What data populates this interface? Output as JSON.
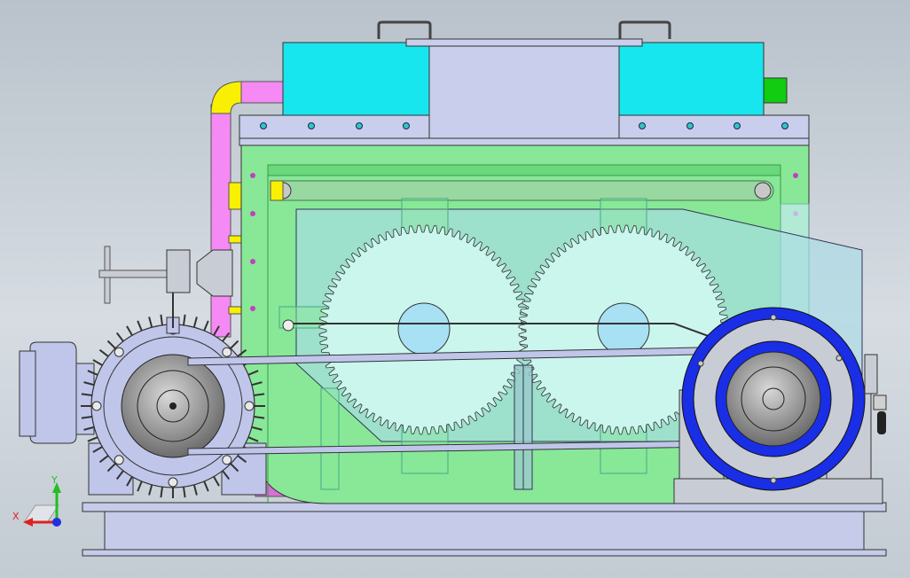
{
  "viewport": {
    "background_top": "#b9c2cb",
    "background_bottom": "#c3cbd3"
  },
  "triad": {
    "x_label": "X",
    "y_label": "Y",
    "x_color": "#e02020",
    "y_color": "#20c020",
    "z_color": "#2030e0"
  },
  "colors": {
    "tank": "#88e898",
    "tank_dark": "#4cc560",
    "hopper": "#18e6ee",
    "cover": "#c8ceeb",
    "gear_fill": "#cbf6ee",
    "gear_hub": "#a8e0f4",
    "gear_guard": "#a9dce6",
    "motor": "#c0c6ea",
    "pulley_ring": "#1a2ee6",
    "pipe": "#f58af5",
    "elbow": "#f8f000",
    "outlet": "#11cc11",
    "base": "#c6cbe9"
  },
  "icons": {
    "triad": "xyz-triad-icon",
    "handwheel": "handwheel-icon"
  }
}
